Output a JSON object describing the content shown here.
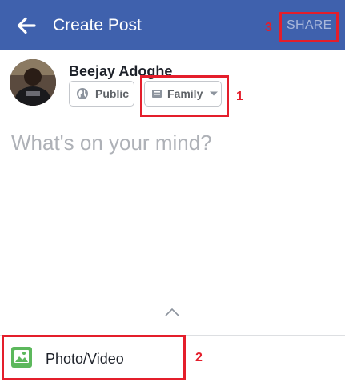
{
  "header": {
    "title": "Create Post",
    "share_label": "SHARE",
    "bg_color": "#3f61ad"
  },
  "user": {
    "name": "Beejay Adoghe"
  },
  "audience": {
    "public_label": "Public",
    "family_label": "Family"
  },
  "composer": {
    "placeholder": "What's on your mind?"
  },
  "actions": {
    "photo_video_label": "Photo/Video"
  },
  "annotations": {
    "one": "1",
    "two": "2",
    "three": "3",
    "color": "#e41e2b"
  },
  "icons": [
    "back-arrow-icon",
    "globe-icon",
    "list-icon",
    "caret-down-icon",
    "chevron-up-icon",
    "photo-icon"
  ]
}
